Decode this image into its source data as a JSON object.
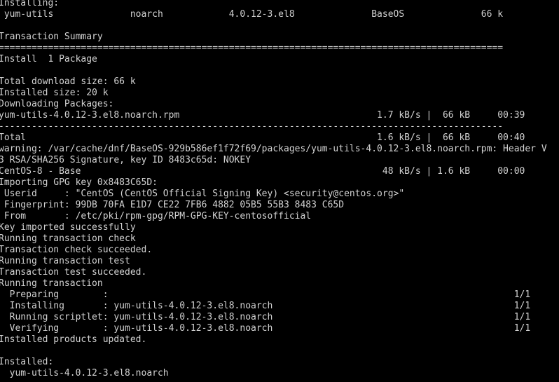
{
  "terminal": {
    "colors": {
      "background": "#000000",
      "foreground": "#d2d2d2"
    },
    "lines": [
      "Installing:",
      " yum-utils              noarch            4.0.12-3.el8              BaseOS              66 k",
      "",
      "Transaction Summary",
      "============================================================================================",
      "Install  1 Package",
      "",
      "Total download size: 66 k",
      "Installed size: 20 k",
      "Downloading Packages:",
      "yum-utils-4.0.12-3.el8.noarch.rpm                                    1.7 kB/s |  66 kB     00:39",
      "--------------------------------------------------------------------------------------------",
      "Total                                                                1.6 kB/s |  66 kB     00:40",
      "warning: /var/cache/dnf/BaseOS-929b586ef1f72f69/packages/yum-utils-4.0.12-3.el8.noarch.rpm: Header V",
      "3 RSA/SHA256 Signature, key ID 8483c65d: NOKEY",
      "CentOS-8 - Base                                                       48 kB/s | 1.6 kB     00:00",
      "Importing GPG key 0x8483C65D:",
      " Userid     : \"CentOS (CentOS Official Signing Key) <security@centos.org>\"",
      " Fingerprint: 99DB 70FA E1D7 CE22 7FB6 4882 05B5 55B3 8483 C65D",
      " From       : /etc/pki/rpm-gpg/RPM-GPG-KEY-centosofficial",
      "Key imported successfully",
      "Running transaction check",
      "Transaction check succeeded.",
      "Running transaction test",
      "Transaction test succeeded.",
      "Running transaction",
      "  Preparing        :                                                                          1/1",
      "  Installing       : yum-utils-4.0.12-3.el8.noarch                                            1/1",
      "  Running scriptlet: yum-utils-4.0.12-3.el8.noarch                                            1/1",
      "  Verifying        : yum-utils-4.0.12-3.el8.noarch                                            1/1",
      "Installed products updated.",
      "",
      "Installed:",
      "  yum-utils-4.0.12-3.el8.noarch"
    ]
  }
}
